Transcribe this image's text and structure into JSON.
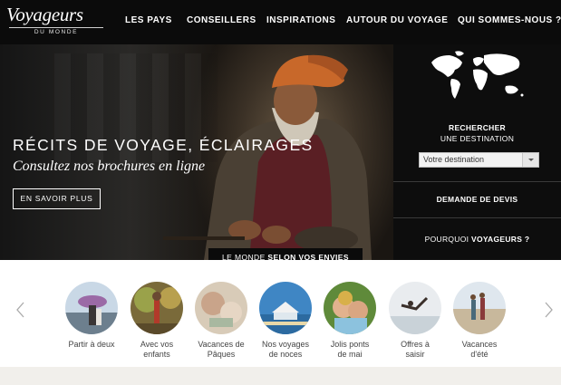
{
  "brand": {
    "name": "Voyageurs",
    "tagline": "DU MONDE"
  },
  "nav": [
    {
      "label": "LES PAYS"
    },
    {
      "label": "CONSEILLERS"
    },
    {
      "label": "INSPIRATIONS"
    },
    {
      "label": "AUTOUR DU VOYAGE"
    },
    {
      "label": "QUI SOMMES-NOUS ?"
    }
  ],
  "hero": {
    "title": "RÉCITS DE VOYAGE, ÉCLAIRAGES",
    "subtitle": "Consultez nos brochures en ligne",
    "cta": "EN SAVOIR PLUS",
    "tab_prefix": "LE MONDE ",
    "tab_bold": "SELON VOS ENVIES"
  },
  "search_panel": {
    "heading_bold": "RECHERCHER",
    "heading": "UNE DESTINATION",
    "select_value": "Votre destination",
    "quote_label": "DEMANDE DE DEVIS",
    "why_prefix": "POURQUOI ",
    "why_bold": "VOYAGEURS ?"
  },
  "carousel": {
    "items": [
      {
        "line1": "Partir à deux",
        "line2": ""
      },
      {
        "line1": "Avec vos",
        "line2": "enfants"
      },
      {
        "line1": "Vacances de",
        "line2": "Pâques"
      },
      {
        "line1": "Nos voyages",
        "line2": "de noces"
      },
      {
        "line1": "Jolis ponts",
        "line2": "de mai"
      },
      {
        "line1": "Offres à",
        "line2": "saisir"
      },
      {
        "line1": "Vacances",
        "line2": "d'été"
      }
    ],
    "prev_icon": "chevron-left-icon",
    "next_icon": "chevron-right-icon"
  },
  "colors": {
    "header_bg": "#0b0b0b",
    "panel_bg": "#0d0d0d",
    "text_light": "#ffffff"
  }
}
